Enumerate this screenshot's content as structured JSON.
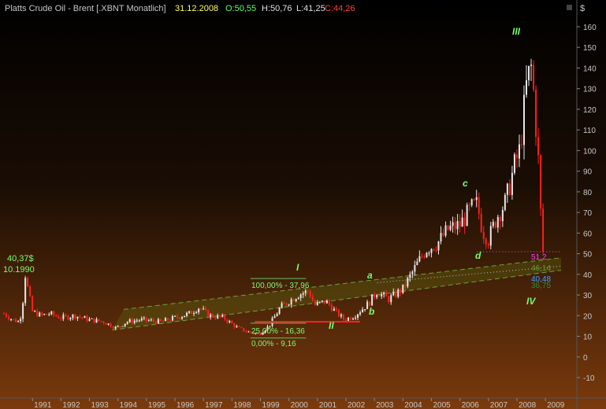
{
  "header": {
    "title": "Platts Crude Oil - Brent [.XBNT  Monatlich]",
    "date": "31.12.2008",
    "open": "O:50,55",
    "high": "H:50,76",
    "low": "L:41,25",
    "close": "C:44,26",
    "currency": "$"
  },
  "colors": {
    "up": "#e8e8e8",
    "down": "#ff2020",
    "label_green": "#7cfc6a",
    "label_pink": "#ff40ff",
    "label_blue": "#40a0ff",
    "fib_green": "#60c060"
  },
  "chart_data": {
    "type": "candlestick",
    "ylim": [
      -10,
      160
    ],
    "y_ticks": [
      "-10",
      "0",
      "10",
      "20",
      "30",
      "40",
      "50",
      "60",
      "70",
      "80",
      "90",
      "100",
      "110",
      "120",
      "130",
      "140",
      "150",
      "160"
    ],
    "x_ticks": [
      "1991",
      "1992",
      "1993",
      "1994",
      "1995",
      "1996",
      "1997",
      "1998",
      "1999",
      "2000",
      "2001",
      "2002",
      "2003",
      "2004",
      "2005",
      "2006",
      "2007",
      "2008",
      "2009"
    ],
    "x_range": [
      1990.0,
      2009.55
    ],
    "series": [
      {
        "x": [
          1990.0,
          1990.3,
          1990.55,
          1990.65,
          1990.75,
          1990.85,
          1991.0,
          1991.3,
          1991.6,
          1992.0,
          1992.5,
          1993.0,
          1993.5,
          1993.95,
          1994.3,
          1994.8,
          1995.5,
          1996.0,
          1996.5,
          1996.85,
          1997.2,
          1997.7,
          1998.2,
          1998.6,
          1998.95,
          1999.3,
          1999.7,
          2000.0,
          2000.3,
          2000.7,
          2000.9,
          2001.3,
          2001.7,
          2001.95,
          2002.3,
          2002.8,
          2003.1,
          2003.25,
          2003.5,
          2004.0,
          2004.5,
          2004.8,
          2005.2,
          2005.6,
          2006.0,
          2006.4,
          2006.6,
          2006.8,
          2007.0,
          2007.3,
          2007.6,
          2007.9,
          2008.1,
          2008.35,
          2008.5,
          2008.6,
          2008.75,
          2008.85,
          2008.95
        ],
        "y": [
          21,
          18,
          17,
          25,
          40,
          32,
          22,
          20,
          21,
          19,
          20,
          18,
          17,
          14,
          17,
          18,
          17,
          19,
          21,
          24,
          20,
          19,
          14,
          12,
          11,
          15,
          24,
          27,
          30,
          32,
          25,
          27,
          21,
          18,
          20,
          26,
          32,
          30,
          28,
          33,
          45,
          52,
          55,
          62,
          64,
          72,
          74,
          61,
          57,
          68,
          75,
          92,
          100,
          133,
          140,
          126,
          95,
          65,
          44.26
        ]
      }
    ],
    "price_labels": {
      "high_1990": "40,37$",
      "high_1990_date": "10.1990",
      "l_51": "51,2",
      "l_46": "46,14",
      "l_40": "40,48",
      "l_36": "36,75"
    },
    "fib_labels": {
      "f100": "100,00% - 37,96",
      "f25": "25,00% - 16,36",
      "f0": "0,00% - 9,16"
    },
    "wave_labels": {
      "I": "I",
      "II": "II",
      "III": "III",
      "IV": "IV",
      "a": "a",
      "b": "b",
      "c": "c",
      "d": "d"
    }
  }
}
